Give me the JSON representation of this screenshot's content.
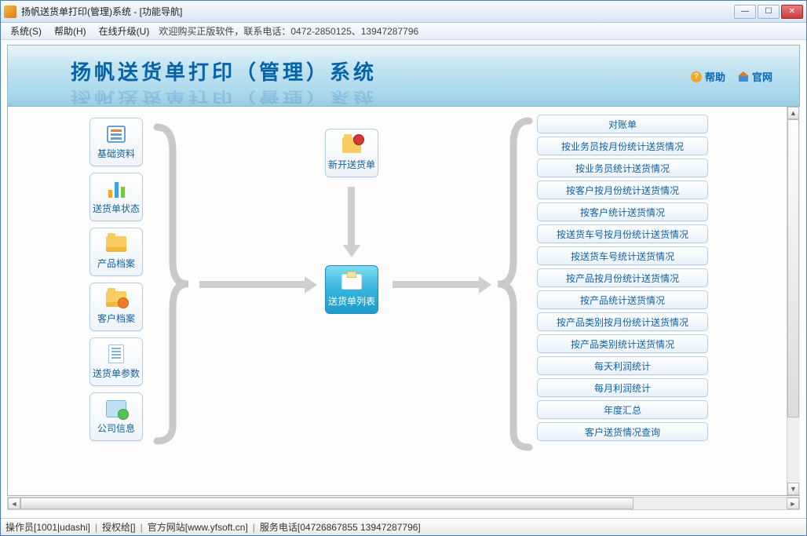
{
  "window": {
    "title": "扬帆送货单打印(管理)系统 - [功能导航]"
  },
  "menu": {
    "system": "系统(S)",
    "help": "帮助(H)",
    "upgrade": "在线升级(U)",
    "promo": "欢迎购买正版软件，联系电话：0472-2850125、13947287796"
  },
  "banner": {
    "title": "扬帆送货单打印（管理）系统",
    "help_label": "帮助",
    "site_label": "官网"
  },
  "tiles": {
    "basic_data": "基础资料",
    "delivery_status": "送货单状态",
    "product_archive": "产品档案",
    "customer_archive": "客户档案",
    "delivery_params": "送货单参数",
    "company_info": "公司信息",
    "new_delivery": "新开送货单",
    "delivery_list": "送货单列表"
  },
  "reports": [
    "对账单",
    "按业务员按月份统计送货情况",
    "按业务员统计送货情况",
    "按客户按月份统计送货情况",
    "按客户统计送货情况",
    "按送货车号按月份统计送货情况",
    "按送货车号统计送货情况",
    "按产品按月份统计送货情况",
    "按产品统计送货情况",
    "按产品类别按月份统计送货情况",
    "按产品类别统计送货情况",
    "每天利润统计",
    "每月利润统计",
    "年度汇总",
    "客户送货情况查询"
  ],
  "status": {
    "operator": "操作员[1001|udashi]",
    "licensed": "授权给[]",
    "site": "官方网站[www.yfsoft.cn]",
    "phone": "服务电话[04726867855 13947287796]"
  }
}
